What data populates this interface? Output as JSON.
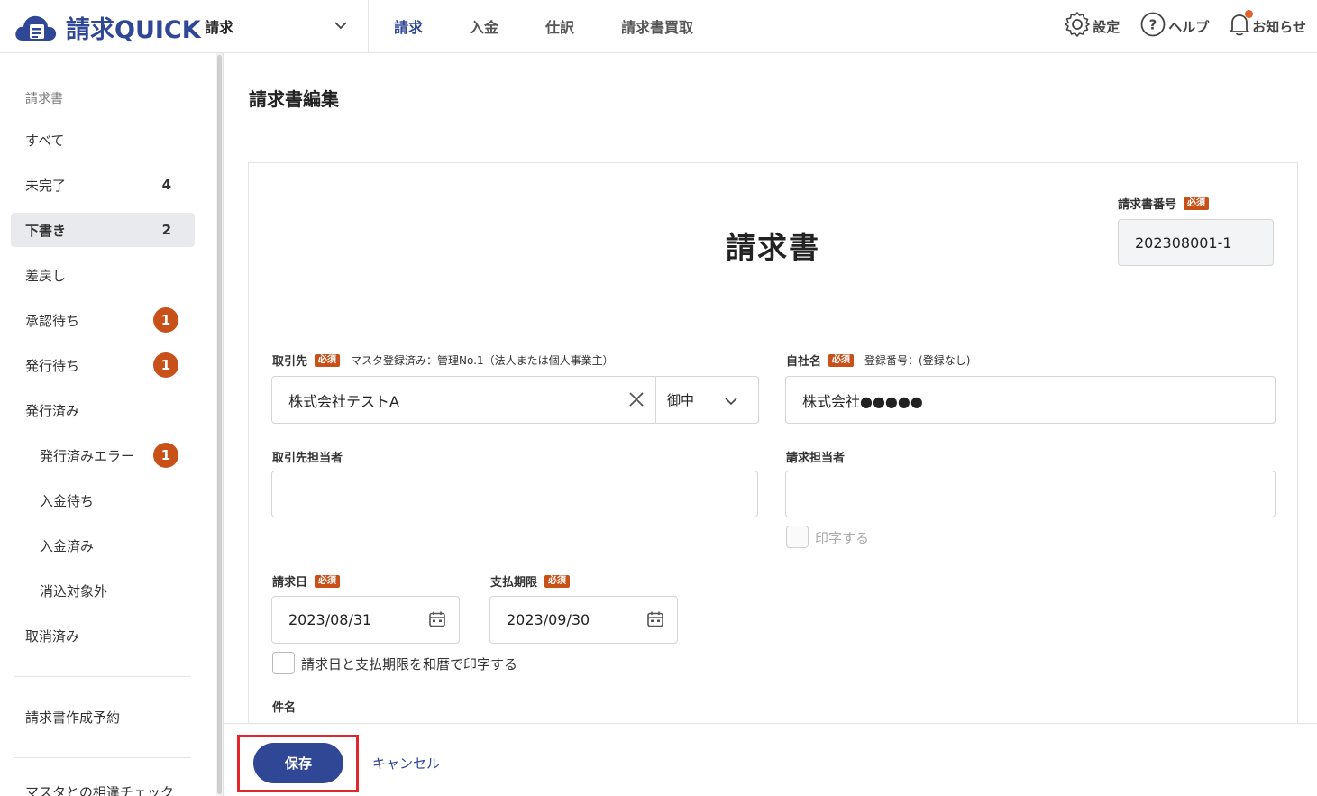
{
  "header": {
    "logo_text": "請求QUICK",
    "app_select": "請求",
    "nav": [
      {
        "label": "請求",
        "active": true
      },
      {
        "label": "入金",
        "active": false
      },
      {
        "label": "仕訳",
        "active": false
      },
      {
        "label": "請求書買取",
        "active": false
      }
    ],
    "settings_label": "設定",
    "help_label": "ヘルプ",
    "notifications_label": "お知らせ"
  },
  "sidebar": {
    "section_label": "請求書",
    "items": [
      {
        "label": "すべて",
        "count": "",
        "badge": ""
      },
      {
        "label": "未完了",
        "count": "4",
        "badge": ""
      },
      {
        "label": "下書き",
        "count": "2",
        "badge": ""
      },
      {
        "label": "差戻し",
        "count": "",
        "badge": ""
      },
      {
        "label": "承認待ち",
        "count": "",
        "badge": "1"
      },
      {
        "label": "発行待ち",
        "count": "",
        "badge": "1"
      },
      {
        "label": "発行済み",
        "count": "",
        "badge": ""
      },
      {
        "label": "発行済みエラー",
        "count": "",
        "badge": "1"
      },
      {
        "label": "入金待ち",
        "count": "",
        "badge": ""
      },
      {
        "label": "入金済み",
        "count": "",
        "badge": ""
      },
      {
        "label": "消込対象外",
        "count": "",
        "badge": ""
      },
      {
        "label": "取消済み",
        "count": "",
        "badge": ""
      }
    ],
    "schedule_label": "請求書作成予約",
    "partial_label": "マスタとの相違チェック"
  },
  "main": {
    "page_title": "請求書編集",
    "doc_title": "請求書",
    "required_tag": "必須",
    "invoice_number": {
      "label": "請求書番号",
      "value": "202308001-1"
    },
    "client": {
      "label": "取引先",
      "note": "マスタ登録済み：管理No.1（法人または個人事業主）",
      "value": "株式会社テストA",
      "honorific": "御中"
    },
    "company": {
      "label": "自社名",
      "note": "登録番号：(登録なし)",
      "value": "株式会社●●●●●"
    },
    "client_contact": {
      "label": "取引先担当者",
      "value": ""
    },
    "billing_contact": {
      "label": "請求担当者",
      "value": ""
    },
    "print_contact_label": "印字する",
    "invoice_date": {
      "label": "請求日",
      "value": "2023/08/31"
    },
    "due_date": {
      "label": "支払期限",
      "value": "2023/09/30"
    },
    "wareki_label": "請求日と支払期限を和暦で印字する",
    "subject_label": "件名"
  },
  "footer": {
    "save_label": "保存",
    "cancel_label": "キャンセル"
  }
}
